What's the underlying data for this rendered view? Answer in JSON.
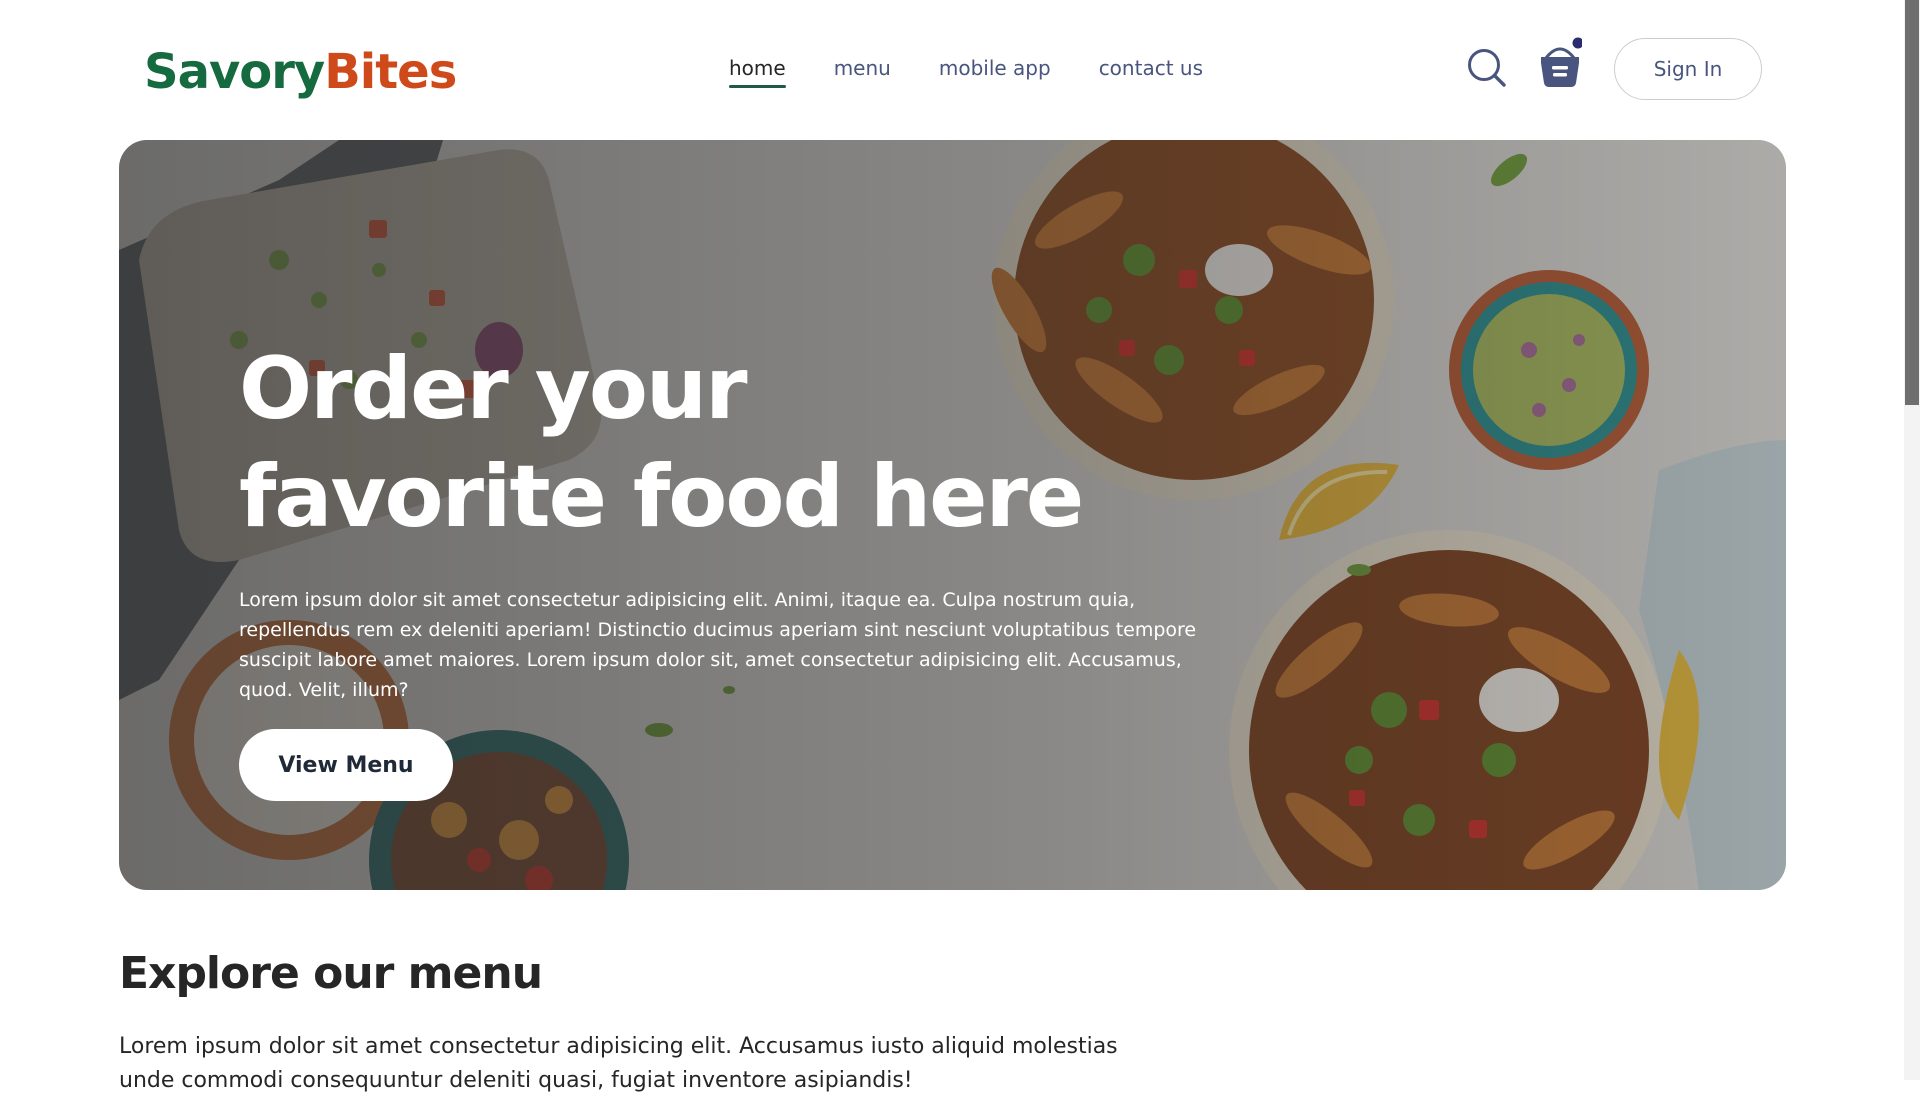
{
  "brand": {
    "part_a": "Savory",
    "part_b": "Bites",
    "color_a": "#156b3f",
    "color_b": "#cf4a1a"
  },
  "nav": {
    "items": [
      {
        "label": "home",
        "active": true
      },
      {
        "label": "menu",
        "active": false
      },
      {
        "label": "mobile app",
        "active": false
      },
      {
        "label": "contact us",
        "active": false
      }
    ],
    "search_icon": "search-icon",
    "cart_icon": "basket-icon",
    "cart_has_items": true,
    "sign_in_label": "Sign In"
  },
  "hero": {
    "title_line1": "Order your",
    "title_line2": "favorite food here",
    "description": "Lorem ipsum dolor sit amet consectetur adipisicing elit. Animi, itaque ea. Culpa nostrum quia, repellendus rem ex deleniti aperiam! Distinctio ducimus aperiam sint nesciunt voluptatibus tempore suscipit labore amet maiores. Lorem ipsum dolor sit, amet consectetur adipisicing elit. Accusamus, quod. Velit, illum?",
    "button_label": "View Menu"
  },
  "explore": {
    "title": "Explore our menu",
    "description": "Lorem ipsum dolor sit amet consectetur adipisicing elit. Accusamus iusto aliquid molestias unde commodi consequuntur deleniti quasi, fugiat inventore asipiandis!"
  },
  "colors": {
    "accent": "#1f5a44",
    "nav_text": "#49557e",
    "cart_dot": "#2b2c6e"
  }
}
